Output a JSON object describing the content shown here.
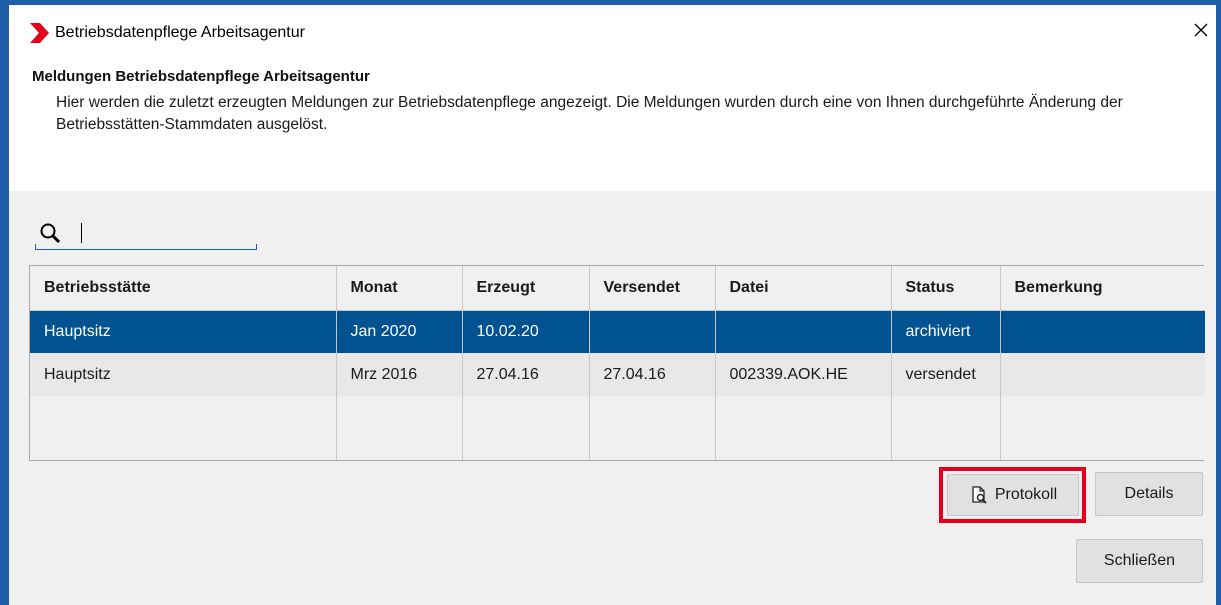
{
  "window": {
    "title": "Betriebsdatenpflege Arbeitsagentur",
    "close_glyph": "✕"
  },
  "header": {
    "heading": "Meldungen Betriebsdatenpflege Arbeitsagentur",
    "description": "Hier werden die zuletzt erzeugten Meldungen zur Betriebsdatenpflege angezeigt. Die Meldungen wurden durch eine von Ihnen durchgeführte Änderung der Betriebsstätten-Stammdaten ausgelöst."
  },
  "search": {
    "value": "",
    "icon": "search-icon"
  },
  "table": {
    "columns": [
      "Betriebsstätte",
      "Monat",
      "Erzeugt",
      "Versendet",
      "Datei",
      "Status",
      "Bemerkung"
    ],
    "rows": [
      [
        "Hauptsitz",
        "Jan 2020",
        "10.02.20",
        "",
        "",
        "archiviert",
        ""
      ],
      [
        "Hauptsitz",
        "Mrz 2016",
        "27.04.16",
        "27.04.16",
        "002339.AOK.HE",
        "versendet",
        ""
      ]
    ],
    "selected_row": 0
  },
  "buttons": {
    "protokoll": "Protokoll",
    "details": "Details",
    "schliessen": "Schließen"
  },
  "colors": {
    "accent": "#1f5ea8",
    "selection": "#005291",
    "highlight": "#e3001b",
    "logo": "#e3001b"
  }
}
